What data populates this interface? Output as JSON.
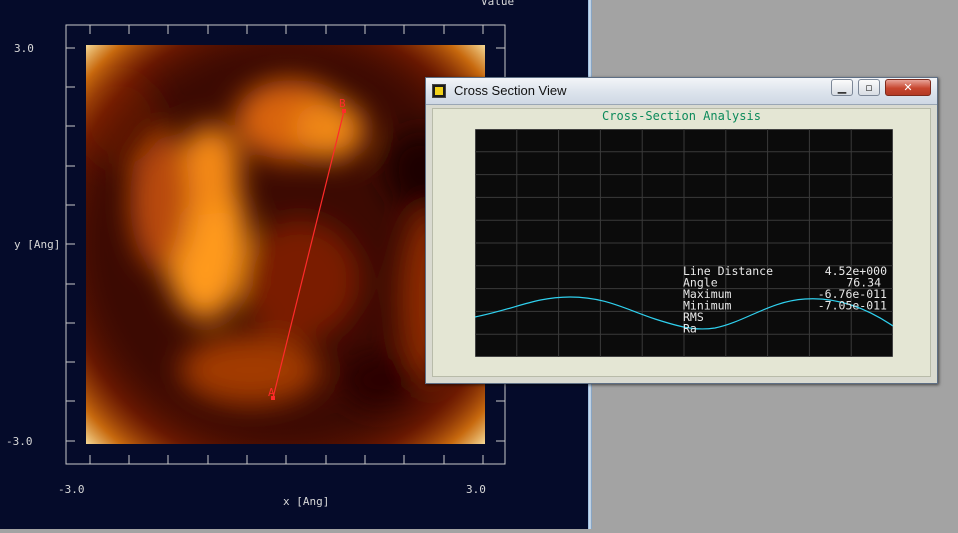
{
  "main_plot": {
    "value_label": "Value",
    "y_axis_label": "y [Ang]",
    "x_axis_label": "x [Ang]",
    "y_max_label": "3.0",
    "y_min_label": "-3.0",
    "x_min_label": "-3.0",
    "x_max_label": "3.0",
    "point_a_label": "A",
    "point_b_label": "B",
    "line_color": "#ff2a2a"
  },
  "cross_section_window": {
    "title": "Cross Section View",
    "heading": "Cross-Section Analysis",
    "minimize_label": "▁",
    "maximize_label": "▫",
    "close_label": "✕",
    "curve_color": "#2fd0ee",
    "heading_color": "#0b8a5a",
    "stats": {
      "line_distance_label": "Line Distance",
      "line_distance_value": "4.52e+000",
      "angle_label": "Angle",
      "angle_value": "76.34",
      "maximum_label": "Maximum",
      "maximum_value": "-6.76e-011",
      "minimum_label": "Minimum",
      "minimum_value": "-7.05e-011",
      "rms_label": "RMS",
      "ra_label": "Ra"
    }
  }
}
